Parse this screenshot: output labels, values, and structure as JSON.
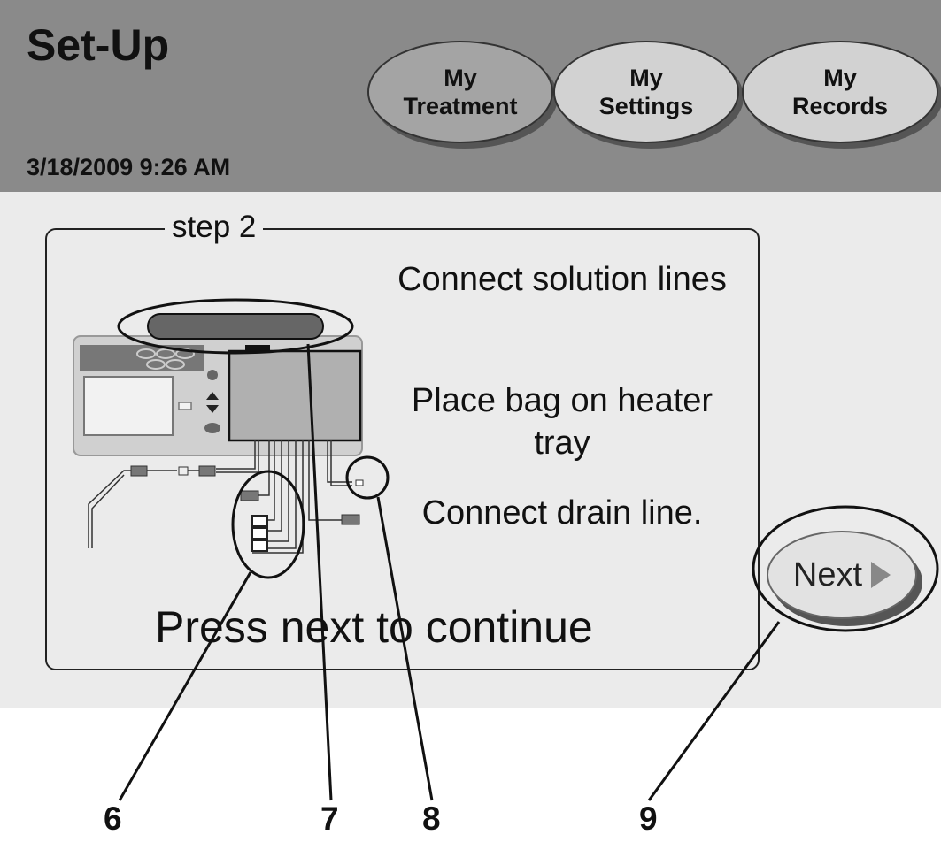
{
  "header": {
    "title": "Set-Up",
    "datetime": "3/18/2009   9:26 AM",
    "tabs": [
      {
        "label": "My\nTreatment"
      },
      {
        "label": "My\nSettings"
      },
      {
        "label": "My\nRecords"
      }
    ]
  },
  "step": {
    "legend": "step 2",
    "instructions": [
      "Connect solution lines",
      "Place bag on heater tray",
      "Connect drain line."
    ],
    "continue_text": "Press next to continue"
  },
  "next_button": {
    "label": "Next",
    "icon": "play-arrow-icon"
  },
  "callouts": [
    "6",
    "7",
    "8",
    "9"
  ],
  "colors": {
    "header": "#8a8a8a",
    "active_tab": "#a4a4a4",
    "inactive_tab": "#d2d2d2",
    "content_bg": "#ebebeb"
  }
}
